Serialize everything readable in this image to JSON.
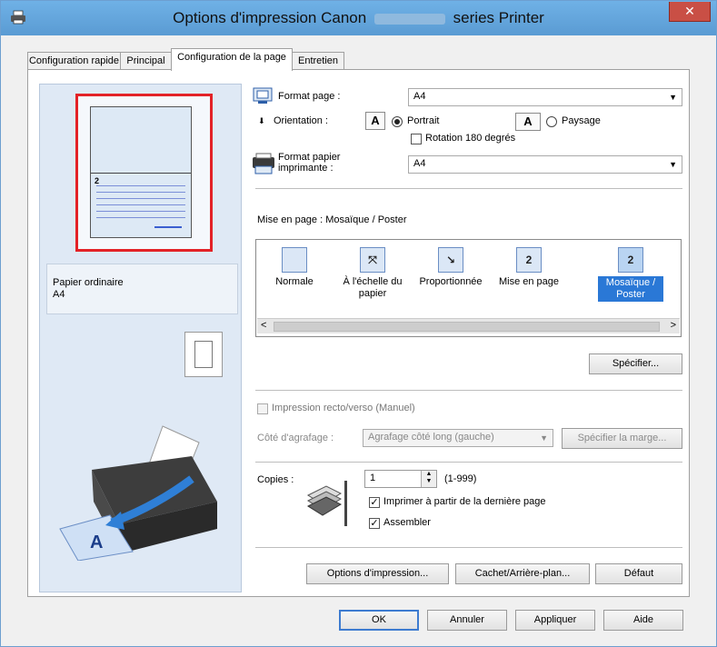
{
  "window": {
    "title_prefix": "Options d'impression Canon",
    "title_suffix": "series Printer",
    "close_symbol": "✕"
  },
  "tabs": [
    {
      "label": "Configuration rapide",
      "active": false
    },
    {
      "label": "Principal",
      "active": false
    },
    {
      "label": "Configuration de la page",
      "active": true
    },
    {
      "label": "Entretien",
      "active": false
    }
  ],
  "preview": {
    "page_number": "2",
    "media_type": "Papier ordinaire",
    "media_size": "A4"
  },
  "page_setup": {
    "page_size_label": "Format page :",
    "page_size_value": "A4",
    "orientation_label": "Orientation :",
    "portrait_label": "Portrait",
    "landscape_label": "Paysage",
    "orientation_selected": "Portrait",
    "rotate_label": "Rotation 180 degrés",
    "rotate_checked": false,
    "printer_paper_label_1": "Format papier",
    "printer_paper_label_2": "imprimante :",
    "printer_paper_value": "A4"
  },
  "layout": {
    "heading": "Mise en page : Mosaïque / Poster",
    "items": [
      {
        "label": "Normale",
        "icon": "normal-icon"
      },
      {
        "label": "À l'échelle du papier",
        "icon": "fit-to-page-icon"
      },
      {
        "label": "Proportionnée",
        "icon": "scaled-icon"
      },
      {
        "label": "Mise en page",
        "icon": "page-layout-icon"
      },
      {
        "label": "Mosaïque / Poster",
        "icon": "tiling-poster-icon"
      }
    ],
    "selected": "Mosaïque / Poster",
    "specify_button": "Spécifier..."
  },
  "duplex": {
    "label": "Impression recto/verso (Manuel)",
    "checked": false,
    "stapling_label": "Côté d'agrafage :",
    "stapling_value": "Agrafage côté long (gauche)",
    "margin_button": "Spécifier la marge..."
  },
  "copies": {
    "label": "Copies :",
    "value": "1",
    "range": "(1-999)",
    "last_page_first_label": "Imprimer à partir de la dernière page",
    "last_page_first_checked": true,
    "collate_label": "Assembler",
    "collate_checked": true
  },
  "bottom_buttons": {
    "print_options": "Options d'impression...",
    "stamp_background": "Cachet/Arrière-plan...",
    "defaults": "Défaut"
  },
  "dialog_buttons": {
    "ok": "OK",
    "cancel": "Annuler",
    "apply": "Appliquer",
    "help": "Aide"
  },
  "check_mark": "✓",
  "scroll_left": "<",
  "scroll_right": ">",
  "dropdown_arrow": "▼",
  "spin_up": "▲",
  "spin_down": "▼"
}
